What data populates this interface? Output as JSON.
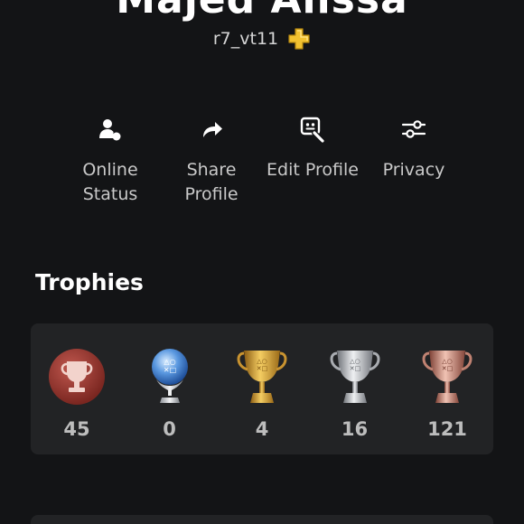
{
  "profile": {
    "display_name": "Majed Alissa",
    "online_id": "r7_vt11"
  },
  "actions": [
    {
      "label": "Online\nStatus",
      "icon": "online-status-icon"
    },
    {
      "label": "Share\nProfile",
      "icon": "share-icon"
    },
    {
      "label": "Edit Profile",
      "icon": "edit-profile-icon"
    },
    {
      "label": "Privacy",
      "icon": "sliders-icon"
    }
  ],
  "trophies": {
    "title": "Trophies",
    "items": [
      {
        "kind": "level",
        "count": "45",
        "color": "#9c3a33"
      },
      {
        "kind": "platinum",
        "count": "0",
        "color": "#6aa8e8"
      },
      {
        "kind": "gold",
        "count": "4",
        "color": "#d9a534"
      },
      {
        "kind": "silver",
        "count": "16",
        "color": "#b9bcc2"
      },
      {
        "kind": "bronze",
        "count": "121",
        "color": "#c98574"
      }
    ]
  },
  "colors": {
    "background": "#131416",
    "card": "#222325",
    "plus_badge": "#f2c230"
  }
}
